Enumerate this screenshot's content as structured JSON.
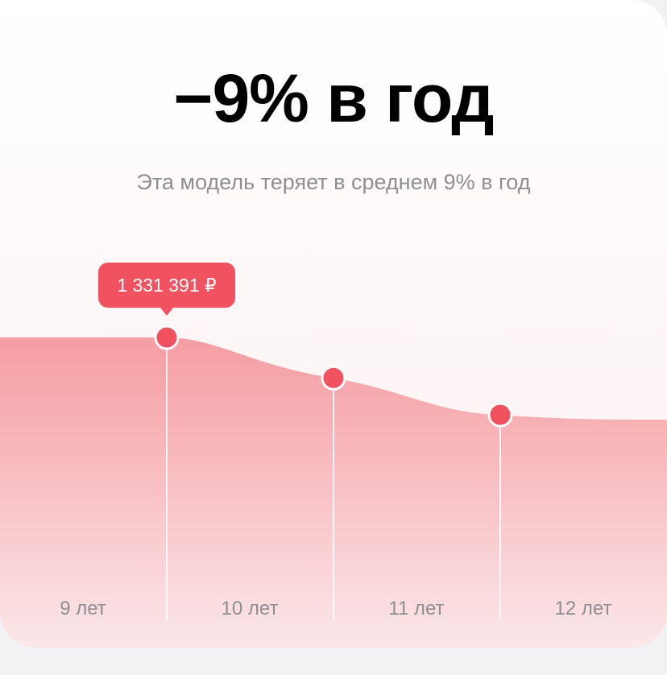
{
  "headline": "−9% в год",
  "subtitle": "Эта модель теряет в среднем 9% в год",
  "colors": {
    "accent": "#f0525f",
    "area_top": "#f59da2",
    "text_secondary": "#8e8e93"
  },
  "chart_data": {
    "type": "area",
    "categories": [
      "9 лет",
      "10 лет",
      "11 лет",
      "12 лет"
    ],
    "series": [
      {
        "values": [
          1331391,
          1211566,
          1102525,
          1003298
        ]
      }
    ],
    "highlighted_index": 0,
    "tooltip": "1 331 391 ₽",
    "grid": false
  }
}
